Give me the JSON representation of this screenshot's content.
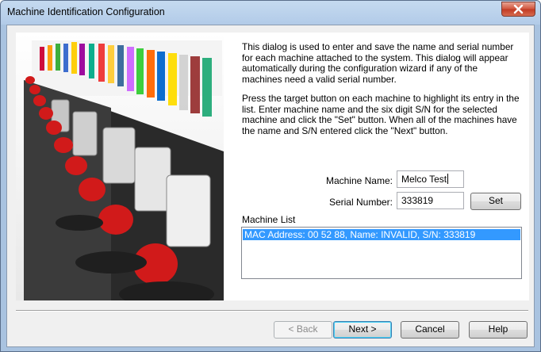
{
  "window": {
    "title": "Machine Identification Configuration"
  },
  "description": {
    "paragraph1": "This dialog is used to enter and save the name and serial number for each machine attached to the system. This dialog will appear automatically during the configuration wizard if any of the machines need a valid serial number.",
    "paragraph2": "Press the target button on each machine to highlight its entry in the list. Enter machine name and the six digit S/N for the selected machine and click the \"Set\" button. When all of the machines have the name and S/N entered click the \"Next\" button."
  },
  "form": {
    "machine_name_label": "Machine Name:",
    "machine_name_value": "Melco Test",
    "serial_number_label": "Serial Number:",
    "serial_number_value": "333819",
    "set_label": "Set"
  },
  "machine_list": {
    "label": "Machine List",
    "items": [
      {
        "text": "MAC Address: 00 52 88, Name: INVALID, S/N: 333819",
        "selected": true
      }
    ]
  },
  "buttons": {
    "back": "< Back",
    "next": "Next >",
    "cancel": "Cancel",
    "help": "Help"
  },
  "colors": {
    "selection": "#3399ff",
    "titlebar": "#b9d1ea",
    "close": "#c7402a"
  }
}
